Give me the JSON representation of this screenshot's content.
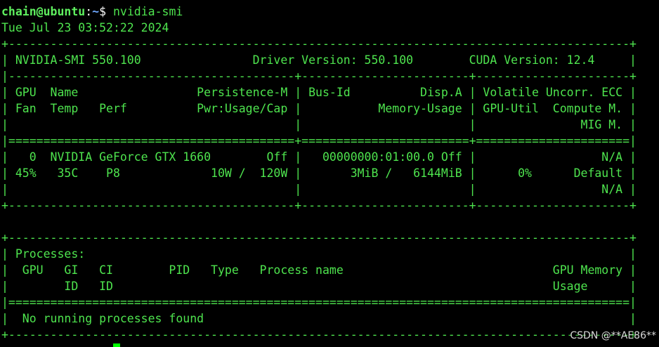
{
  "terminal": {
    "prompt": {
      "user_host": "chain@ubuntu",
      "colon": ":",
      "path": "~",
      "dollar": "$ ",
      "command": "nvidia-smi"
    },
    "timestamp": "Tue Jul 23 03:52:22 2024",
    "output_lines": [
      "+-----------------------------------------------------------------------------------------+",
      "| NVIDIA-SMI 550.100                Driver Version: 550.100        CUDA Version: 12.4     |",
      "|-----------------------------------------+------------------------+----------------------+",
      "| GPU  Name                 Persistence-M | Bus-Id          Disp.A | Volatile Uncorr. ECC |",
      "| Fan  Temp   Perf          Pwr:Usage/Cap |           Memory-Usage | GPU-Util  Compute M. |",
      "|                                         |                        |               MIG M. |",
      "|=========================================+========================+======================|",
      "|   0  NVIDIA GeForce GTX 1660        Off |   00000000:01:00.0 Off |                  N/A |",
      "| 45%   35C    P8             10W /  120W |       3MiB /   6144MiB |      0%      Default |",
      "|                                         |                        |                  N/A |",
      "+-----------------------------------------+------------------------+----------------------+",
      "",
      "+-----------------------------------------------------------------------------------------+",
      "| Processes:                                                                              |",
      "|  GPU   GI   CI        PID   Type   Process name                              GPU Memory |",
      "|        ID   ID                                                               Usage      |",
      "|=========================================================================================|",
      "|  No running processes found                                                             |",
      "+-----------------------------------------------------------------------------------------+"
    ],
    "final_prompt": "chain@ubuntu:~$ "
  },
  "watermark": {
    "text": "CSDN @**AE86**"
  },
  "colors": {
    "background": "#000000",
    "text": "#4ee44e",
    "prompt_user": "#5ff05f",
    "prompt_path": "#6fa8ff",
    "cursor": "#00ff00"
  }
}
